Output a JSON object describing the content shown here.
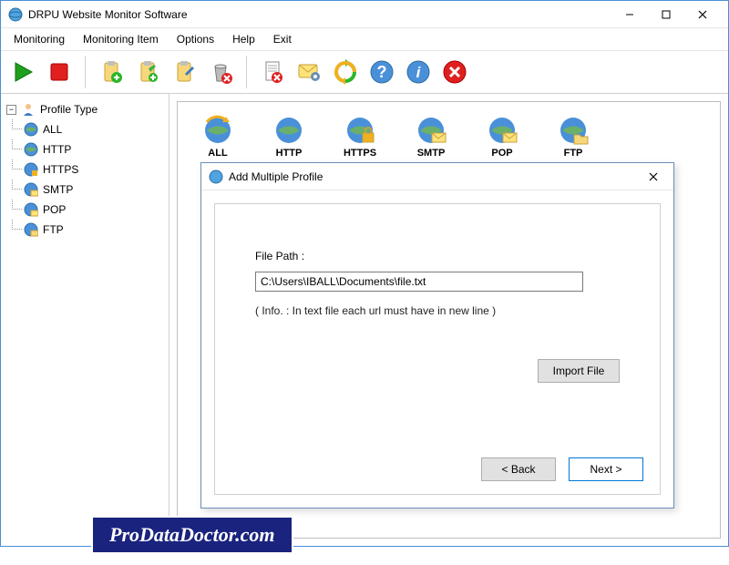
{
  "window": {
    "title": "DRPU Website Monitor Software",
    "min": "minimize",
    "max": "maximize",
    "close": "close"
  },
  "menu": {
    "items": [
      "Monitoring",
      "Monitoring Item",
      "Options",
      "Help",
      "Exit"
    ]
  },
  "toolbar": {
    "icons": [
      "play",
      "stop",
      "clipboard-add",
      "clipboard-plus",
      "clipboard-edit",
      "trash-delete",
      "page-delete",
      "mail-settings",
      "refresh",
      "help-q",
      "info",
      "cancel"
    ]
  },
  "sidebar": {
    "root": "Profile Type",
    "items": [
      "ALL",
      "HTTP",
      "HTTPS",
      "SMTP",
      "POP",
      "FTP"
    ]
  },
  "protocols": [
    "ALL",
    "HTTP",
    "HTTPS",
    "SMTP",
    "POP",
    "FTP"
  ],
  "dialog": {
    "title": "Add Multiple Profile",
    "file_label": "File Path :",
    "file_value": "C:\\Users\\IBALL\\Documents\\file.txt",
    "info": "( Info. : In text file each url must have in new line )",
    "import": "Import File",
    "back": "< Back",
    "next": "Next >"
  },
  "watermark": "ProDataDoctor.com"
}
